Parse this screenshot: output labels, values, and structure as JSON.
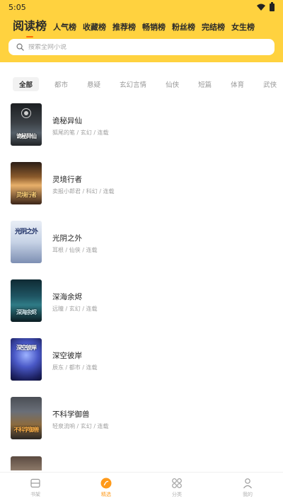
{
  "status": {
    "time": "5:05"
  },
  "tabs": [
    "阅读榜",
    "人气榜",
    "收藏榜",
    "推荐榜",
    "畅销榜",
    "粉丝榜",
    "完结榜",
    "女生榜"
  ],
  "search": {
    "placeholder": "搜索全网小说"
  },
  "categories": [
    "全部",
    "都市",
    "悬疑",
    "玄幻言情",
    "仙侠",
    "短篇",
    "体育",
    "武侠"
  ],
  "books": [
    {
      "title": "诡秘异仙",
      "meta": "狐尾的笔 / 玄幻 / 连载",
      "cover_text": "诡秘异仙"
    },
    {
      "title": "灵境行者",
      "meta": "卖报小郎君 / 科幻 / 连载",
      "cover_text": "灵境行者"
    },
    {
      "title": "光阴之外",
      "meta": "耳根 / 仙侠 / 连载",
      "cover_text": "光阴之外"
    },
    {
      "title": "深海余烬",
      "meta": "远瞳 / 玄幻 / 连载",
      "cover_text": "深海余烬"
    },
    {
      "title": "深空彼岸",
      "meta": "辰东 / 都市 / 连载",
      "cover_text": "深空彼岸"
    },
    {
      "title": "不科学御兽",
      "meta": "轻泉流响 / 玄幻 / 连载",
      "cover_text": "不科学御兽"
    }
  ],
  "nav": [
    {
      "label": "书架",
      "icon": "bookshelf-icon"
    },
    {
      "label": "精选",
      "icon": "featured-icon"
    },
    {
      "label": "分类",
      "icon": "category-icon"
    },
    {
      "label": "我的",
      "icon": "profile-icon"
    }
  ],
  "colors": {
    "header_bg": "#ffd23f",
    "accent": "#ff9a1a",
    "tab_underline": "#ff6a00"
  }
}
